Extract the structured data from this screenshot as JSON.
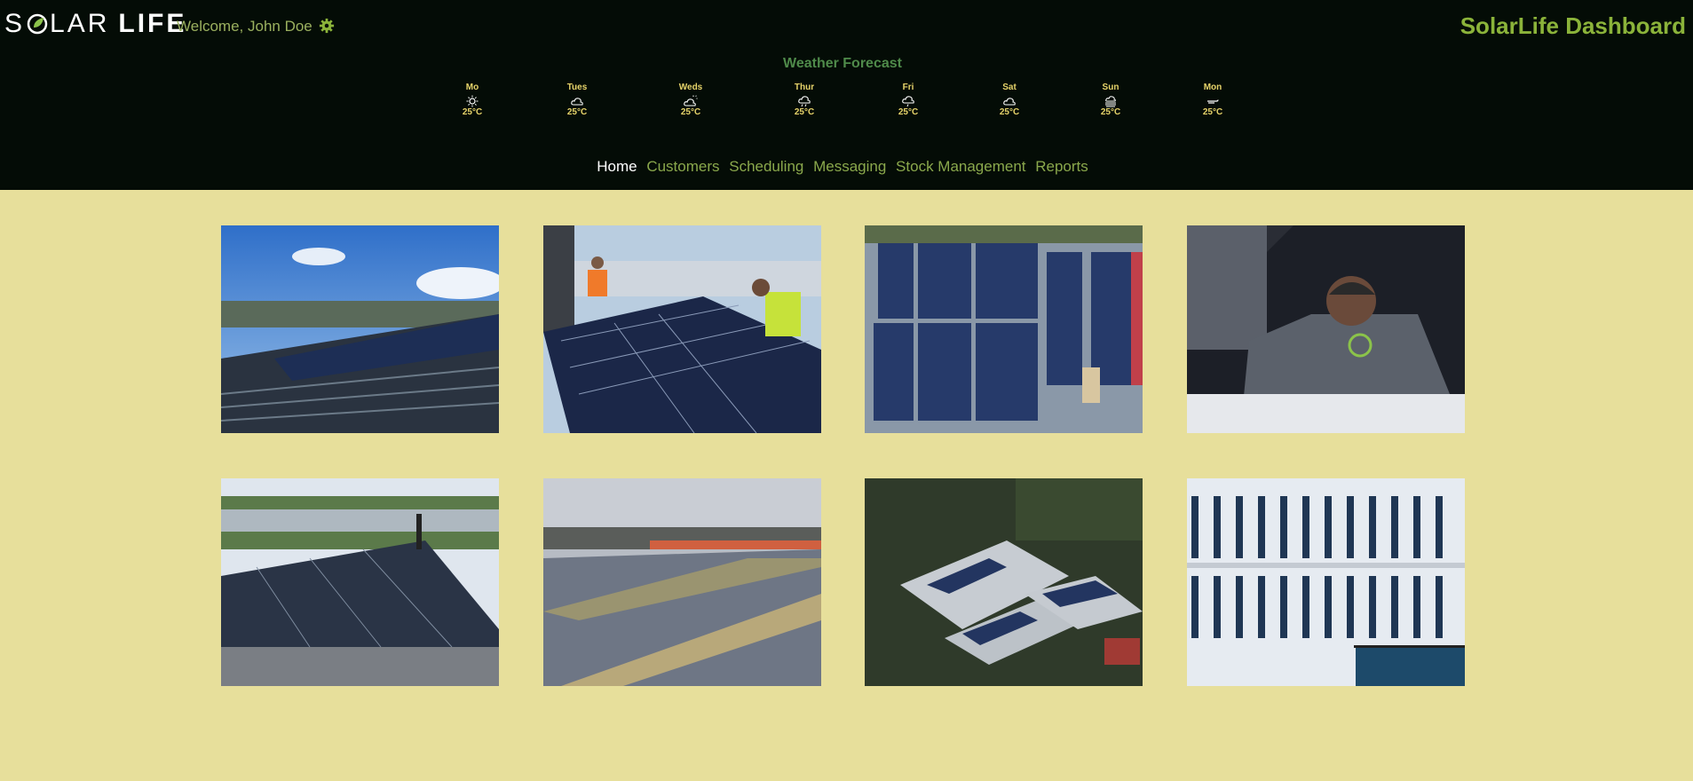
{
  "header": {
    "logo_part1": "S",
    "logo_part1b": "LAR",
    "logo_part2": "LIFE",
    "welcome": "Welcome, John Doe",
    "dashboard_title": "SolarLife Dashboard"
  },
  "forecast": {
    "title": "Weather Forecast",
    "days": [
      {
        "label": "Mo",
        "temp": "25°C",
        "icon": "sun-icon"
      },
      {
        "label": "Tues",
        "temp": "25°C",
        "icon": "cloud-icon"
      },
      {
        "label": "Weds",
        "temp": "25°C",
        "icon": "partly-cloudy-icon"
      },
      {
        "label": "Thur",
        "temp": "25°C",
        "icon": "rain-cloud-icon"
      },
      {
        "label": "Fri",
        "temp": "25°C",
        "icon": "rain-cloud-icon"
      },
      {
        "label": "Sat",
        "temp": "25°C",
        "icon": "cloud-icon"
      },
      {
        "label": "Sun",
        "temp": "25°C",
        "icon": "fog-icon"
      },
      {
        "label": "Mon",
        "temp": "25°C",
        "icon": "wind-icon"
      }
    ]
  },
  "nav": {
    "home": "Home",
    "customers": "Customers",
    "scheduling": "Scheduling",
    "messaging": "Messaging",
    "stock": "Stock Management",
    "reports": "Reports"
  },
  "colors": {
    "header_bg": "#040c06",
    "page_bg": "#e7df9b",
    "accent_green": "#8bb33a",
    "forecast_yellow": "#e7d46a"
  }
}
